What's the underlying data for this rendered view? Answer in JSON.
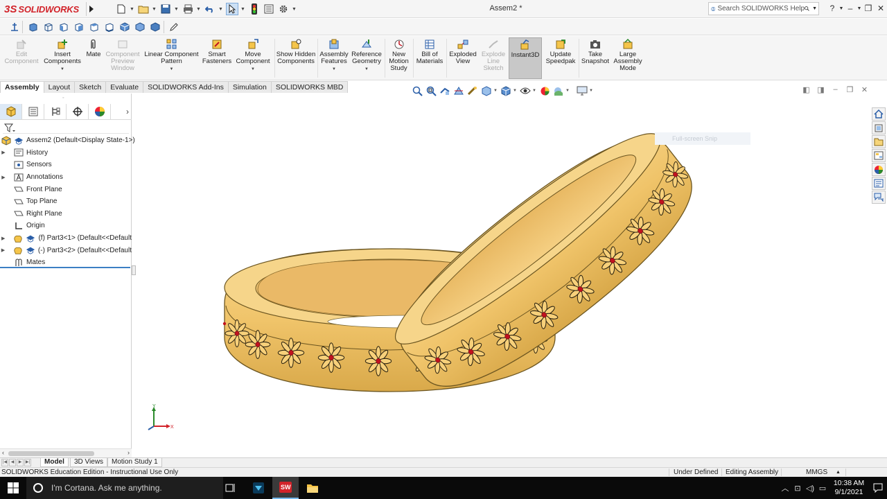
{
  "app": {
    "logo_text": "SOLIDWORKS",
    "doc_title": "Assem2 *",
    "search_placeholder": "Search SOLIDWORKS Help"
  },
  "ribbon": {
    "buttons": [
      {
        "id": "edit_component",
        "label": "Edit Component",
        "disabled": true
      },
      {
        "id": "insert_components",
        "label": "Insert Components"
      },
      {
        "id": "mate",
        "label": "Mate"
      },
      {
        "id": "component_preview",
        "label": "Component Preview Window",
        "disabled": true
      },
      {
        "id": "linear_pattern",
        "label": "Linear Component Pattern"
      },
      {
        "id": "smart_fasteners",
        "label": "Smart Fasteners"
      },
      {
        "id": "move_component",
        "label": "Move Component"
      },
      {
        "id": "show_hidden",
        "label": "Show Hidden Components"
      },
      {
        "id": "assembly_features",
        "label": "Assembly Features"
      },
      {
        "id": "reference_geometry",
        "label": "Reference Geometry"
      },
      {
        "id": "new_motion_study",
        "label": "New Motion Study"
      },
      {
        "id": "bill_of_materials",
        "label": "Bill of Materials"
      },
      {
        "id": "exploded_view",
        "label": "Exploded View"
      },
      {
        "id": "explode_line_sketch",
        "label": "Explode Line Sketch",
        "disabled": true
      },
      {
        "id": "instant3d",
        "label": "Instant3D",
        "active": true
      },
      {
        "id": "update_speedpak",
        "label": "Update Speedpak"
      },
      {
        "id": "take_snapshot",
        "label": "Take Snapshot"
      },
      {
        "id": "large_assembly_mode",
        "label": "Large Assembly Mode"
      }
    ]
  },
  "tabs": [
    "Assembly",
    "Layout",
    "Sketch",
    "Evaluate",
    "SOLIDWORKS Add-Ins",
    "Simulation",
    "SOLIDWORKS MBD"
  ],
  "active_tab": "Assembly",
  "tree": {
    "root": "Assem2  (Default<Display State-1>)",
    "items": [
      {
        "label": "History",
        "expandable": true
      },
      {
        "label": "Sensors",
        "expandable": false
      },
      {
        "label": "Annotations",
        "expandable": true
      },
      {
        "label": "Front Plane",
        "expandable": false
      },
      {
        "label": "Top Plane",
        "expandable": false
      },
      {
        "label": "Right Plane",
        "expandable": false
      },
      {
        "label": "Origin",
        "expandable": false
      },
      {
        "label": "(f) Part3<1> (Default<<Default",
        "expandable": true
      },
      {
        "label": "(-) Part3<2> (Default<<Default",
        "expandable": true
      },
      {
        "label": "Mates",
        "expandable": false
      }
    ]
  },
  "viewport": {
    "snip_label": "Full-screen Snip",
    "triad_x": "X",
    "triad_y": "Y"
  },
  "bottom_tabs": [
    "Model",
    "3D Views",
    "Motion Study 1"
  ],
  "active_bottom_tab": "Model",
  "status": {
    "edition": "SOLIDWORKS Education Edition - Instructional Use Only",
    "defined": "Under Defined",
    "editing": "Editing Assembly",
    "units": "MMGS"
  },
  "taskbar": {
    "cortana_text": "I'm Cortana. Ask me anything.",
    "time": "10:38 AM",
    "date": "9/1/2021"
  },
  "colors": {
    "brand_red": "#d2232a",
    "ring_gold": "#f0c46a",
    "flower_gem": "#c1121f"
  }
}
